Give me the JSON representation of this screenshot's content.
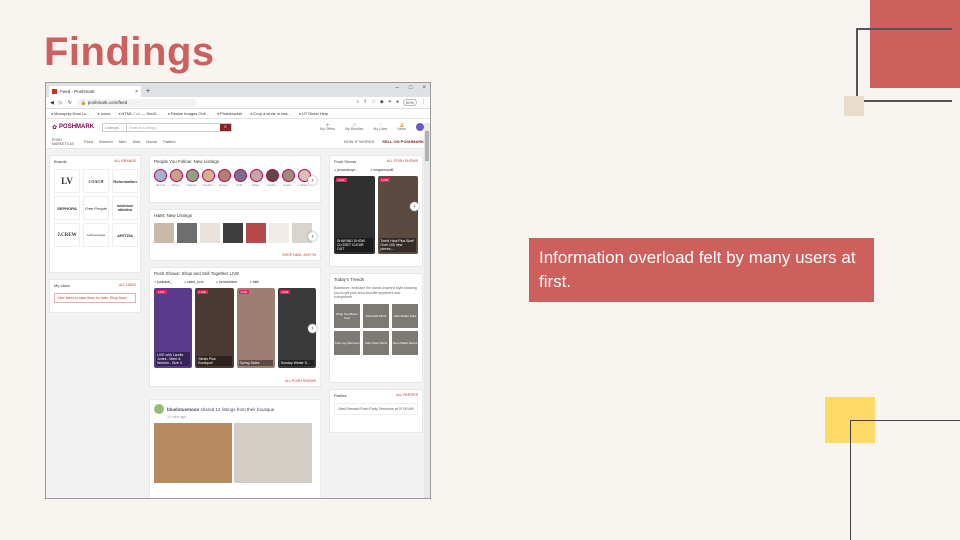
{
  "slide": {
    "title": "Findings",
    "callout": "Information overload felt by many users at first."
  },
  "browser": {
    "tab_title": "Feed - Poshmark",
    "url": "poshmark.com/feed",
    "zoom": "90%",
    "bookmarks": [
      "Monopoly Deal Lo...",
      "Icons",
      "HTML / <> — SenD...",
      "Resize Images Onli...",
      "Photobucket",
      "Crop a circle in ima...",
      "UT Direct Help"
    ]
  },
  "poshmark": {
    "logo": "POSHMARK",
    "search_scope": "Listings",
    "search_placeholder": "Search Listings",
    "header_icons": [
      "My Offers",
      "My Bundles",
      "My Likes",
      "News"
    ],
    "market": "POSH MARKETS All",
    "nav": [
      "Feed",
      "Women",
      "Men",
      "Kids",
      "Home",
      "Parties"
    ],
    "how_it_works": "HOW IT WORKS",
    "sell": "SELL ON POSHMARK",
    "brands": {
      "title": "Brands",
      "link": "ALL BRANDS",
      "items": [
        "LV",
        "COACH",
        "Reformation",
        "SEPHORA",
        "Free People",
        "lululemon athletica",
        "J.CREW",
        "Anthropologie",
        "ARITZIA"
      ]
    },
    "likes": {
      "title": "My Likes",
      "link": "ALL LIKES",
      "text": "'Like' items to save them for later. Shop Now!"
    },
    "follow": {
      "title": "People You Follow: New Listings",
      "names": [
        "dbcclts",
        "fishey...",
        "Ottavia...",
        "maudlin...",
        "amsey...",
        "thrift...",
        "raffan...",
        "mindsy...",
        "vhabo...",
        "polkam..."
      ]
    },
    "hm": {
      "title": "H&M: New Listings",
      "link": "SHOP H&M: JUST IN"
    },
    "shows": {
      "title": "Posh Shows: Shop and Sell Together LIVE",
      "hosts": [
        "justkatal_",
        "claire_luxe",
        "lornatobfaer",
        "faith"
      ],
      "captions": [
        "LIVE with Laurits Jones - Meet & Women - Size 3",
        "Steals Plus Boutique!",
        "Spring Sales",
        "Sunday Winter S..."
      ],
      "live": "LIVE",
      "link": "ALL POSH SHOWS"
    },
    "post": {
      "user": "bluelotusmoon",
      "action": "shared 12 listings from their boutique",
      "time": "19 mins ago"
    },
    "posh_shows": {
      "title": "Posh Shows",
      "link": "ALL POSH SHOWS",
      "hosts": [
        "jenrantcoye...",
        "meganroyal6"
      ],
      "tiles": [
        "SHARING SHOW CLOSET CLEAR OUT",
        "Torrid Haul Plus Size! Over 100 new pieces,..."
      ]
    },
    "trends": {
      "title": "Today's Trends",
      "text": "Balletcore: embrace the dance-inspired style showing you to get pink and pinsulite anywhere and everywhere.",
      "tiles": [
        "Wrap Top Blazer Tops",
        "Pink Midi Skirts",
        "Satin Ballet Flats",
        "Tulle Leg Warmers",
        "Satin Maxi Skirts",
        "Shop Ballet Wears"
      ]
    },
    "parties": {
      "title": "Parties",
      "link": "ALL PARTIES",
      "item": "Best Dressed Posh Party Tomorrow at 07:00 AM"
    }
  }
}
